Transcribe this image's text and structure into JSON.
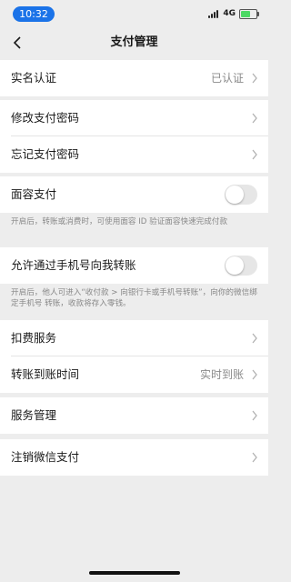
{
  "status_bar": {
    "time": "10:32",
    "network": "4G"
  },
  "nav": {
    "title": "支付管理"
  },
  "rows": {
    "real_name": {
      "label": "实名认证",
      "value": "已认证"
    },
    "change_password": {
      "label": "修改支付密码"
    },
    "forgot_password": {
      "label": "忘记支付密码"
    },
    "face_pay": {
      "label": "面容支付",
      "enabled": false
    },
    "phone_transfer": {
      "label": "允许通过手机号向我转账",
      "enabled": false
    },
    "deduction": {
      "label": "扣费服务"
    },
    "transfer_time": {
      "label": "转账到账时间",
      "value": "实时到账"
    },
    "service_mgmt": {
      "label": "服务管理"
    },
    "cancel_pay": {
      "label": "注销微信支付"
    }
  },
  "notes": {
    "face_pay": "开启后，转账或消费时，可使用面容 ID 验证面容快速完成付款",
    "phone_transfer": "开启后，他人可进入“收付款 > 向银行卡或手机号转账”，向你的微信绑定手机号                    转账，收款将存入零钱。"
  },
  "colors": {
    "background": "#ededed",
    "status_pill": "#1b73e8",
    "secondary_text": "#888888"
  }
}
